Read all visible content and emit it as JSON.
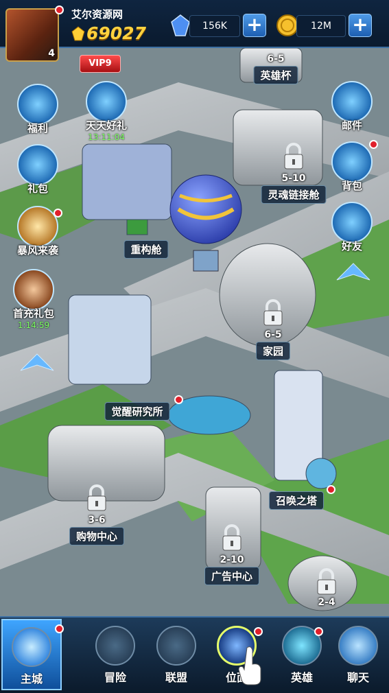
{
  "header": {
    "player_name": "艾尔资源网",
    "score": "69027",
    "avatar_level": "4",
    "gems": "156K",
    "gold": "12M",
    "vip": "VIP9"
  },
  "side_left": [
    {
      "label": "福利",
      "timer": ""
    },
    {
      "label": "天天好礼",
      "timer": "13:11:04"
    },
    {
      "label": "礼包",
      "timer": ""
    },
    {
      "label": "暴风来袭",
      "timer": ""
    },
    {
      "label": "首充礼包",
      "timer": "1:14:59"
    }
  ],
  "side_right": [
    {
      "label": "邮件"
    },
    {
      "label": "背包"
    },
    {
      "label": "好友"
    }
  ],
  "buildings": [
    {
      "name": "英雄杯",
      "level": "6-5"
    },
    {
      "name": "灵魂链接舱",
      "level": "5-10"
    },
    {
      "name": "重构舱",
      "level": ""
    },
    {
      "name": "家园",
      "level": "6-5"
    },
    {
      "name": "觉醒研究所",
      "level": ""
    },
    {
      "name": "召唤之塔",
      "level": ""
    },
    {
      "name": "购物中心",
      "level": "3-6"
    },
    {
      "name": "广告中心",
      "level": "2-10"
    },
    {
      "name": "",
      "level": "2-4"
    }
  ],
  "tabs": [
    {
      "label": "主城"
    },
    {
      "label": "冒险"
    },
    {
      "label": "联盟"
    },
    {
      "label": "位面"
    },
    {
      "label": "英雄"
    },
    {
      "label": "聊天"
    }
  ]
}
